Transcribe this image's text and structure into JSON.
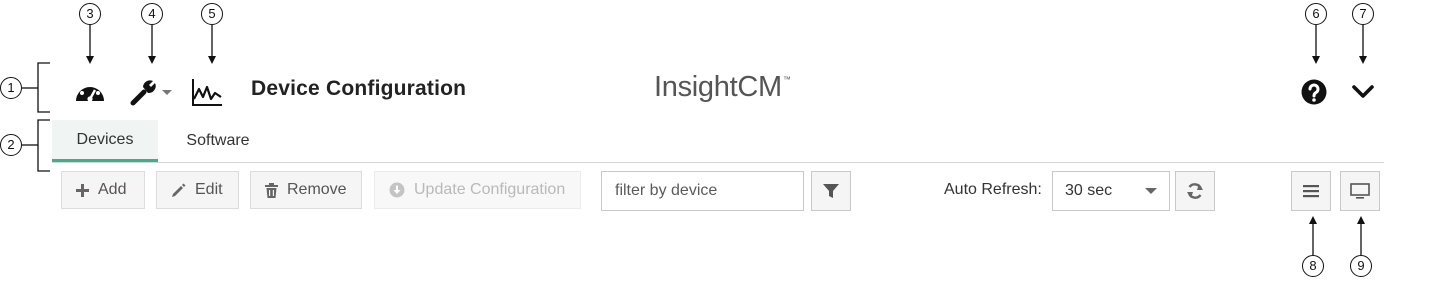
{
  "header": {
    "title": "Device Configuration",
    "brand": "InsightCM",
    "brand_mark": "™",
    "icons": [
      "dashboard-icon",
      "wrench-icon",
      "waveform-icon",
      "help-icon",
      "chevron-down-icon"
    ]
  },
  "tabs": [
    {
      "label": "Devices",
      "active": true
    },
    {
      "label": "Software",
      "active": false
    }
  ],
  "toolbar": {
    "add_label": "Add",
    "edit_label": "Edit",
    "remove_label": "Remove",
    "update_label": "Update Configuration",
    "filter_placeholder": "filter by device",
    "auto_refresh_label": "Auto Refresh:",
    "auto_refresh_value": "30 sec"
  },
  "callouts": [
    "1",
    "2",
    "3",
    "4",
    "5",
    "6",
    "7",
    "8",
    "9"
  ],
  "colors": {
    "accent": "#3fae8b",
    "tab_active_bg": "#f0f5f3"
  }
}
